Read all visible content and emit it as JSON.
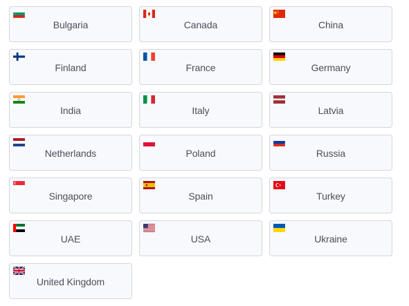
{
  "countries": [
    {
      "name": "Bulgaria",
      "flag": "bulgaria-flag-icon"
    },
    {
      "name": "Canada",
      "flag": "canada-flag-icon"
    },
    {
      "name": "China",
      "flag": "china-flag-icon"
    },
    {
      "name": "Finland",
      "flag": "finland-flag-icon"
    },
    {
      "name": "France",
      "flag": "france-flag-icon"
    },
    {
      "name": "Germany",
      "flag": "germany-flag-icon"
    },
    {
      "name": "India",
      "flag": "india-flag-icon"
    },
    {
      "name": "Italy",
      "flag": "italy-flag-icon"
    },
    {
      "name": "Latvia",
      "flag": "latvia-flag-icon"
    },
    {
      "name": "Netherlands",
      "flag": "netherlands-flag-icon"
    },
    {
      "name": "Poland",
      "flag": "poland-flag-icon"
    },
    {
      "name": "Russia",
      "flag": "russia-flag-icon"
    },
    {
      "name": "Singapore",
      "flag": "singapore-flag-icon"
    },
    {
      "name": "Spain",
      "flag": "spain-flag-icon"
    },
    {
      "name": "Turkey",
      "flag": "turkey-flag-icon"
    },
    {
      "name": "UAE",
      "flag": "uae-flag-icon"
    },
    {
      "name": "USA",
      "flag": "usa-flag-icon"
    },
    {
      "name": "Ukraine",
      "flag": "ukraine-flag-icon"
    },
    {
      "name": "United Kingdom",
      "flag": "united-kingdom-flag-icon"
    }
  ]
}
